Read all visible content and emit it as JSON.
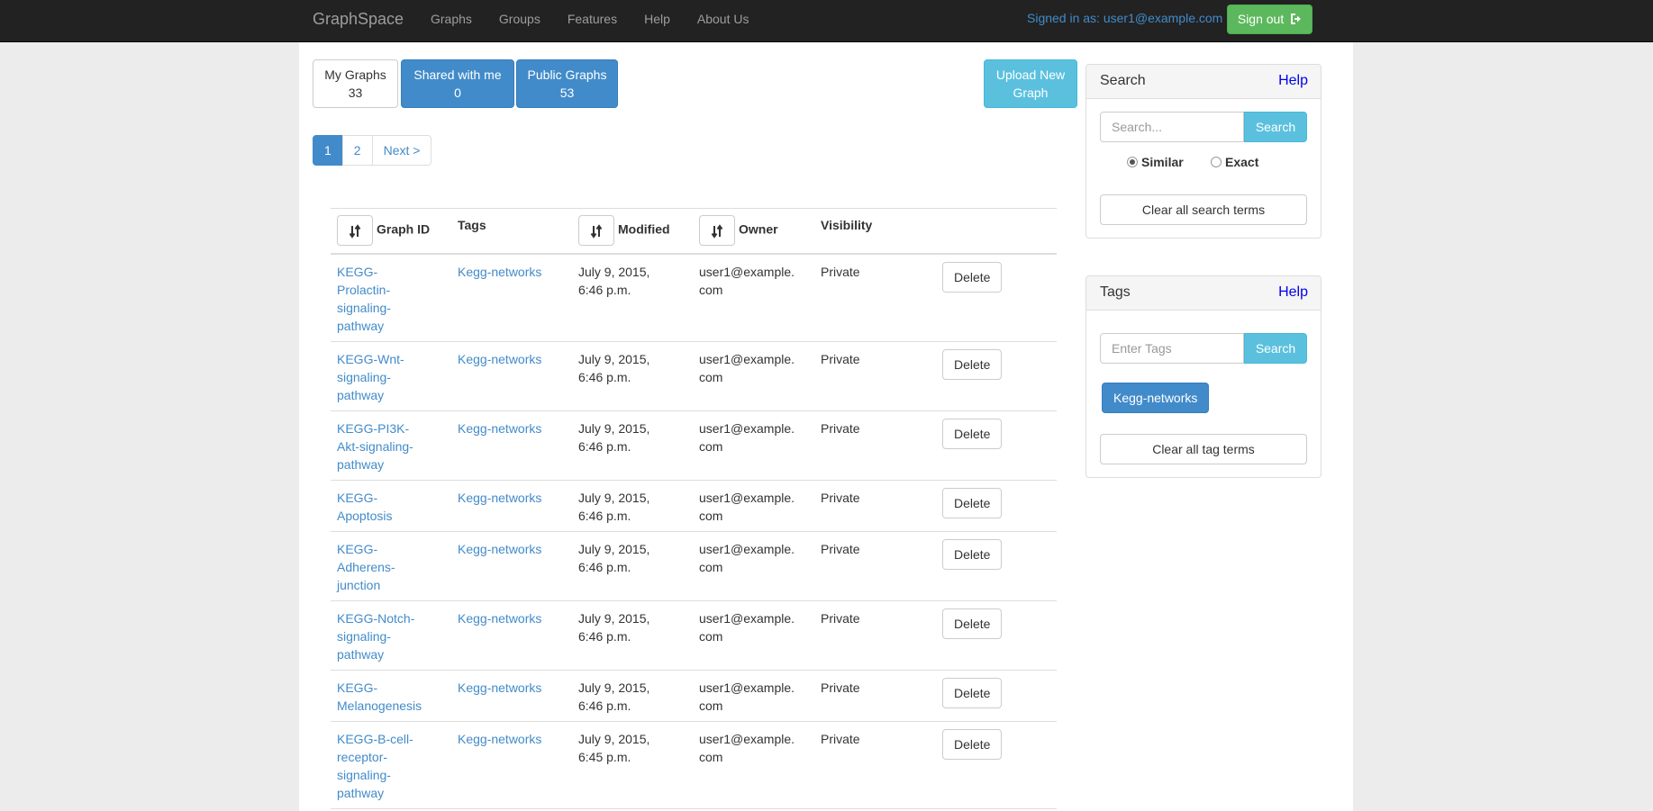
{
  "navbar": {
    "brand": "GraphSpace",
    "links": [
      "Graphs",
      "Groups",
      "Features",
      "Help",
      "About Us"
    ],
    "signed_in": "Signed in as: user1@example.com",
    "signout_label": "Sign out"
  },
  "tabs": {
    "my_graphs": {
      "label": "My Graphs",
      "count": "33"
    },
    "shared": {
      "label": "Shared with me",
      "count": "0"
    },
    "public": {
      "label": "Public Graphs",
      "count": "53"
    },
    "upload": {
      "line1": "Upload New",
      "line2": "Graph"
    }
  },
  "pagination": {
    "pages": [
      "1",
      "2"
    ],
    "next": "Next >",
    "active": "1"
  },
  "table": {
    "headers": {
      "graph_id": "Graph ID",
      "tags": "Tags",
      "modified": "Modified",
      "owner": "Owner",
      "visibility": "Visibility"
    },
    "delete_label": "Delete",
    "rows": [
      {
        "id": "KEGG-Prolactin-signaling-pathway",
        "tag": "Kegg-networks",
        "modified": "July 9, 2015, 6:46 p.m.",
        "owner": "user1@example.com",
        "visibility": "Private"
      },
      {
        "id": "KEGG-Wnt-signaling-pathway",
        "tag": "Kegg-networks",
        "modified": "July 9, 2015, 6:46 p.m.",
        "owner": "user1@example.com",
        "visibility": "Private"
      },
      {
        "id": "KEGG-PI3K-Akt-signaling-pathway",
        "tag": "Kegg-networks",
        "modified": "July 9, 2015, 6:46 p.m.",
        "owner": "user1@example.com",
        "visibility": "Private"
      },
      {
        "id": "KEGG-Apoptosis",
        "tag": "Kegg-networks",
        "modified": "July 9, 2015, 6:46 p.m.",
        "owner": "user1@example.com",
        "visibility": "Private"
      },
      {
        "id": "KEGG-Adherens-junction",
        "tag": "Kegg-networks",
        "modified": "July 9, 2015, 6:46 p.m.",
        "owner": "user1@example.com",
        "visibility": "Private"
      },
      {
        "id": "KEGG-Notch-signaling-pathway",
        "tag": "Kegg-networks",
        "modified": "July 9, 2015, 6:46 p.m.",
        "owner": "user1@example.com",
        "visibility": "Private"
      },
      {
        "id": "KEGG-Melanogenesis",
        "tag": "Kegg-networks",
        "modified": "July 9, 2015, 6:46 p.m.",
        "owner": "user1@example.com",
        "visibility": "Private"
      },
      {
        "id": "KEGG-B-cell-receptor-signaling-pathway",
        "tag": "Kegg-networks",
        "modified": "July 9, 2015, 6:45 p.m.",
        "owner": "user1@example.com",
        "visibility": "Private"
      }
    ]
  },
  "search_panel": {
    "title": "Search",
    "help": "Help",
    "placeholder": "Search...",
    "button": "Search",
    "radio_similar": "Similar",
    "radio_exact": "Exact",
    "clear": "Clear all search terms"
  },
  "tags_panel": {
    "title": "Tags",
    "help": "Help",
    "placeholder": "Enter Tags",
    "button": "Search",
    "chip": "Kegg-networks",
    "clear": "Clear all tag terms"
  },
  "colors": {
    "primary": "#428bca",
    "info": "#5bc0de",
    "success": "#5cb85c",
    "navbar": "#222222"
  }
}
